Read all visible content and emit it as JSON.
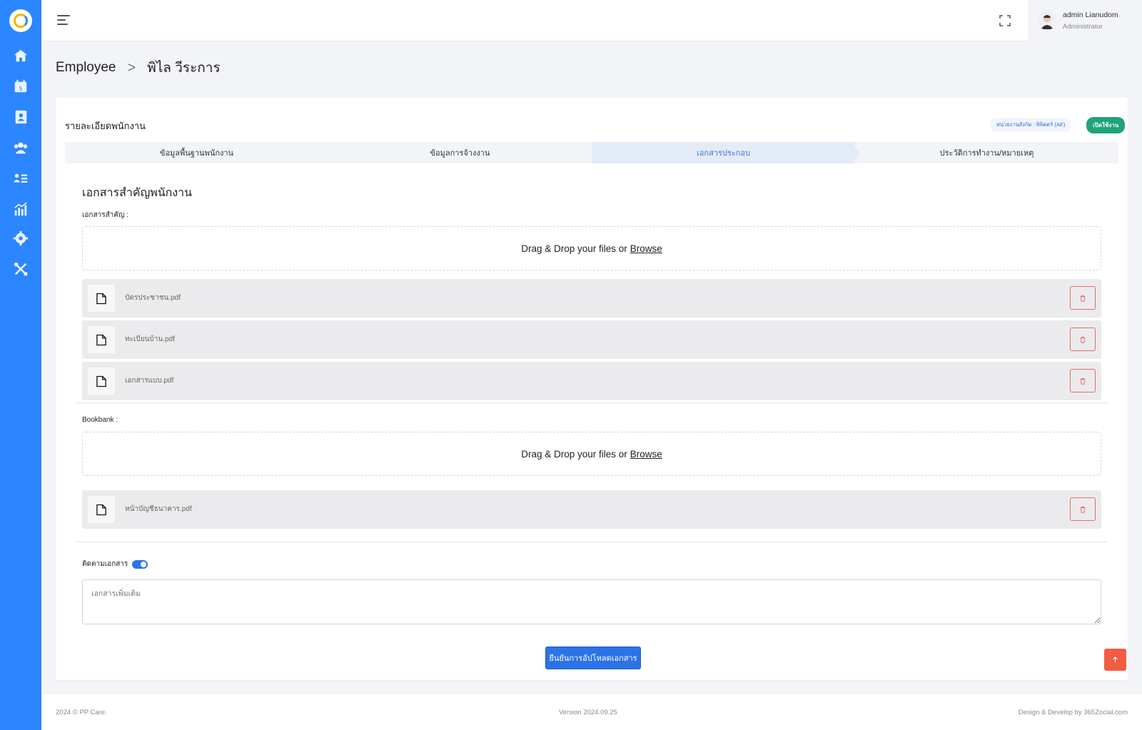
{
  "sidebar": {
    "items": [
      {
        "icon": "home-icon"
      },
      {
        "icon": "calendar-payment-icon"
      },
      {
        "icon": "contact-book-icon"
      },
      {
        "icon": "employees-icon"
      },
      {
        "icon": "user-list-icon"
      },
      {
        "icon": "chart-icon"
      },
      {
        "icon": "settings-icon"
      },
      {
        "icon": "tools-icon"
      }
    ],
    "accent": "#2b86ff"
  },
  "topbar": {
    "user_name": "admin Lianudom",
    "user_role": "Administrator"
  },
  "breadcrumb": {
    "parent": "Employee",
    "separator": ">",
    "current": "พิไล วีระการ"
  },
  "card": {
    "title": "รายละเอียดพนักงาน",
    "dept_badge": "หน่วยงานสังกัด : พิพิตตร์ (AE)",
    "status_badge": "เปิดใช้งาน"
  },
  "tabs": [
    {
      "label": "ข้อมูลพื้นฐานพนักงาน"
    },
    {
      "label": "ข้อมูลการจ้างงาน"
    },
    {
      "label": "เอกสารประกอบ"
    },
    {
      "label": "ประวัติการทำงาน/หมายเหตุ"
    }
  ],
  "documents": {
    "section_title": "เอกสารสำคัญพนักงาน",
    "important_label": "เอกสารสำคัญ :",
    "dropzone_text": "Drag & Drop your files or",
    "dropzone_browse": "Browse",
    "important_files": [
      {
        "name": "บัตรประชาชน.pdf"
      },
      {
        "name": "ทะเบียนบ้าน.pdf"
      },
      {
        "name": "เอกสารแบบ.pdf"
      }
    ],
    "bookbank_label": "Bookbank :",
    "bookbank_files": [
      {
        "name": "หน้าบัญชีธนาคาร.pdf"
      }
    ],
    "track_label": "ติดตามเอกสาร",
    "track_enabled": true,
    "notes_placeholder": "เอกสารเพิ่มเติม",
    "submit_label": "ยืนยันการอัปโหลดเอกสาร"
  },
  "footer": {
    "copyright": "2024 © PP Care.",
    "version": "Version 2024.09.25",
    "developer": "Design & Develop by 365Zocial.com"
  },
  "colors": {
    "primary": "#2b73e6",
    "danger": "#e0705e",
    "success": "#1fa37a"
  }
}
